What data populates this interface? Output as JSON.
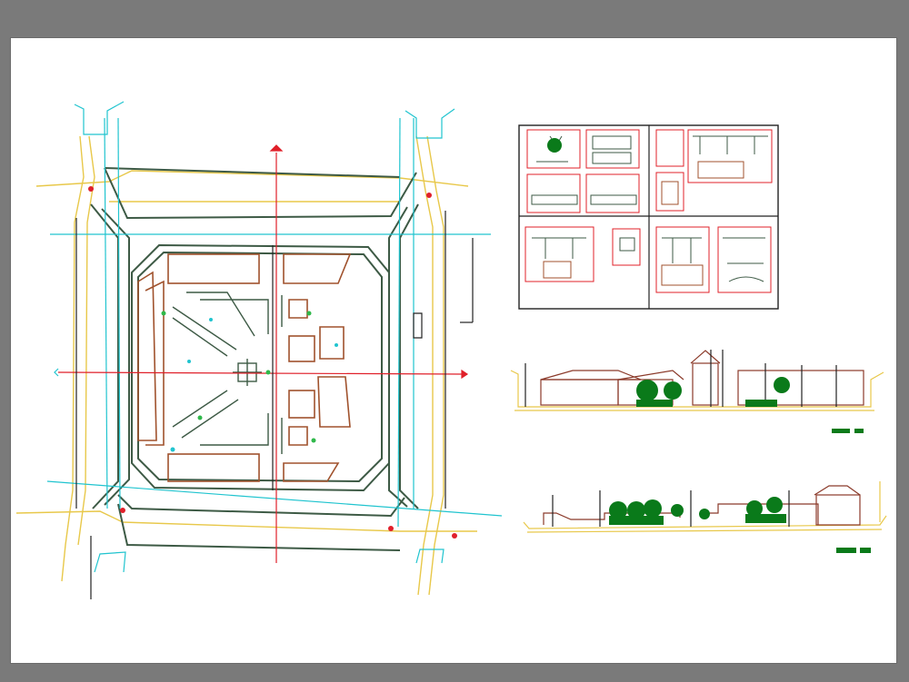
{
  "drawing": {
    "colors": {
      "viewport_bg": "#7a7a7a",
      "sheet_bg": "#ffffff",
      "wall": "#3d5a45",
      "axis": "#e0202a",
      "grid": "#20c4cf",
      "curb": "#e8c84a",
      "building": "#8b3a2a",
      "planter": "#a0522d",
      "tree": "#0a7a1a",
      "frame": "#222222",
      "detail_border": "#e0202a"
    },
    "views": [
      "site-plan",
      "details-sheet",
      "elevation-1",
      "elevation-2"
    ]
  }
}
